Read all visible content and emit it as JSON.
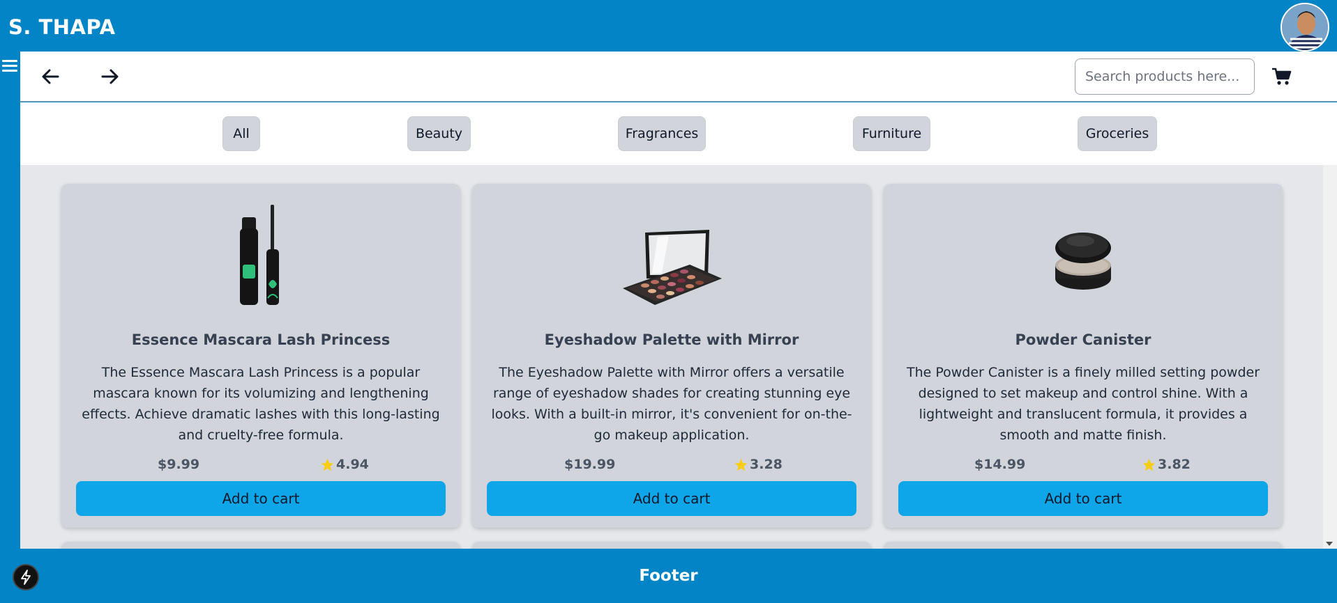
{
  "header": {
    "brand": "S. THAPA"
  },
  "topbar": {
    "search_placeholder": "Search products here..."
  },
  "filters": [
    "All",
    "Beauty",
    "Fragrances",
    "Furniture",
    "Groceries"
  ],
  "products": [
    {
      "title": "Essence Mascara Lash Princess",
      "description": "The Essence Mascara Lash Princess is a popular mascara known for its volumizing and lengthening effects. Achieve dramatic lashes with this long-lasting and cruelty-free formula.",
      "price": "$9.99",
      "rating": "4.94",
      "button_label": "Add to cart",
      "image": "mascara"
    },
    {
      "title": "Eyeshadow Palette with Mirror",
      "description": "The Eyeshadow Palette with Mirror offers a versatile range of eyeshadow shades for creating stunning eye looks. With a built-in mirror, it's convenient for on-the-go makeup application.",
      "price": "$19.99",
      "rating": "3.28",
      "button_label": "Add to cart",
      "image": "eyeshadow-palette"
    },
    {
      "title": "Powder Canister",
      "description": "The Powder Canister is a finely milled setting powder designed to set makeup and control shine. With a lightweight and translucent formula, it provides a smooth and matte finish.",
      "price": "$14.99",
      "rating": "3.82",
      "button_label": "Add to cart",
      "image": "powder-canister"
    }
  ],
  "footer": {
    "label": "Footer"
  },
  "colors": {
    "primary": "#0284c7",
    "button": "#0ea5e9",
    "card": "#d1d5db",
    "star": "#facc15"
  },
  "icons": [
    "menu-icon",
    "arrow-left-icon",
    "arrow-right-icon",
    "cart-icon",
    "star-icon",
    "bolt-icon"
  ]
}
